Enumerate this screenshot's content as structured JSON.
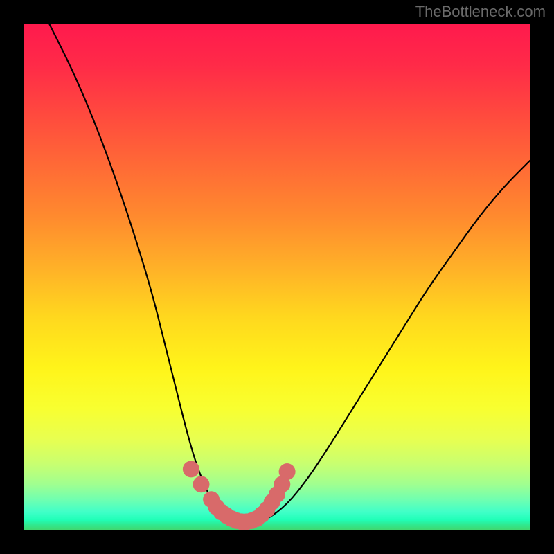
{
  "watermark": "TheBottleneck.com",
  "chart_data": {
    "type": "line",
    "title": "",
    "xlabel": "",
    "ylabel": "",
    "xlim": [
      0,
      100
    ],
    "ylim": [
      0,
      100
    ],
    "series": [
      {
        "name": "bottleneck-curve",
        "x": [
          5,
          10,
          15,
          20,
          25,
          28,
          30,
          32,
          34,
          36,
          38,
          40,
          42,
          45,
          48,
          52,
          56,
          60,
          65,
          70,
          75,
          80,
          85,
          90,
          95,
          100
        ],
        "y": [
          100,
          90,
          78,
          64,
          48,
          36,
          28,
          20,
          13,
          8,
          4,
          2,
          1,
          1,
          2,
          5,
          10,
          16,
          24,
          32,
          40,
          48,
          55,
          62,
          68,
          73
        ]
      }
    ],
    "markers": {
      "name": "highlight-dots",
      "x": [
        33,
        35,
        37,
        38,
        39,
        40,
        41,
        42,
        43,
        44,
        45,
        46,
        47,
        48,
        49,
        50,
        51,
        52
      ],
      "y": [
        12,
        9,
        6,
        4.5,
        3.5,
        2.8,
        2.2,
        1.8,
        1.6,
        1.6,
        1.8,
        2.2,
        3,
        4,
        5.5,
        7,
        9,
        11.5
      ]
    }
  },
  "colors": {
    "curve": "#000000",
    "marker": "#d86a6a"
  }
}
